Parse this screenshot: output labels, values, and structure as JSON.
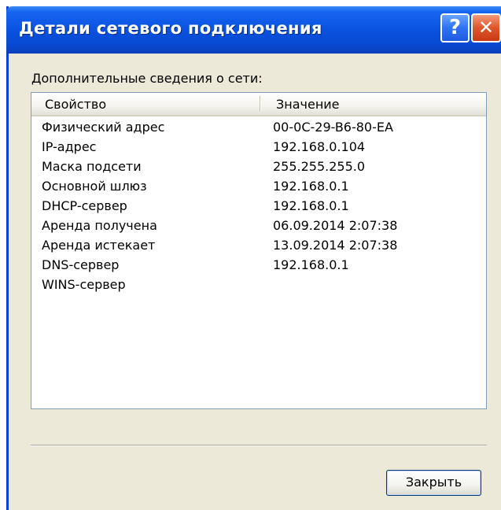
{
  "window": {
    "title": "Детали сетевого подключения",
    "help_label": "?",
    "close_label": "✕"
  },
  "caption": "Дополнительные сведения о сети:",
  "list": {
    "columns": [
      "Свойство",
      "Значение"
    ],
    "rows": [
      {
        "property": "Физический адрес",
        "value": "00-0C-29-B6-80-EA"
      },
      {
        "property": "IP-адрес",
        "value": "192.168.0.104"
      },
      {
        "property": "Маска подсети",
        "value": "255.255.255.0"
      },
      {
        "property": "Основной шлюз",
        "value": "192.168.0.1"
      },
      {
        "property": "DHCP-сервер",
        "value": "192.168.0.1"
      },
      {
        "property": "Аренда получена",
        "value": "06.09.2014 2:07:38"
      },
      {
        "property": "Аренда истекает",
        "value": "13.09.2014 2:07:38"
      },
      {
        "property": "DNS-сервер",
        "value": "192.168.0.1"
      },
      {
        "property": "WINS-сервер",
        "value": ""
      }
    ]
  },
  "buttons": {
    "close_label": "Закрыть"
  },
  "colors": {
    "titlebar": "#0a52e0",
    "close_button": "#e0552b",
    "dialog_bg": "#ece9d8"
  }
}
